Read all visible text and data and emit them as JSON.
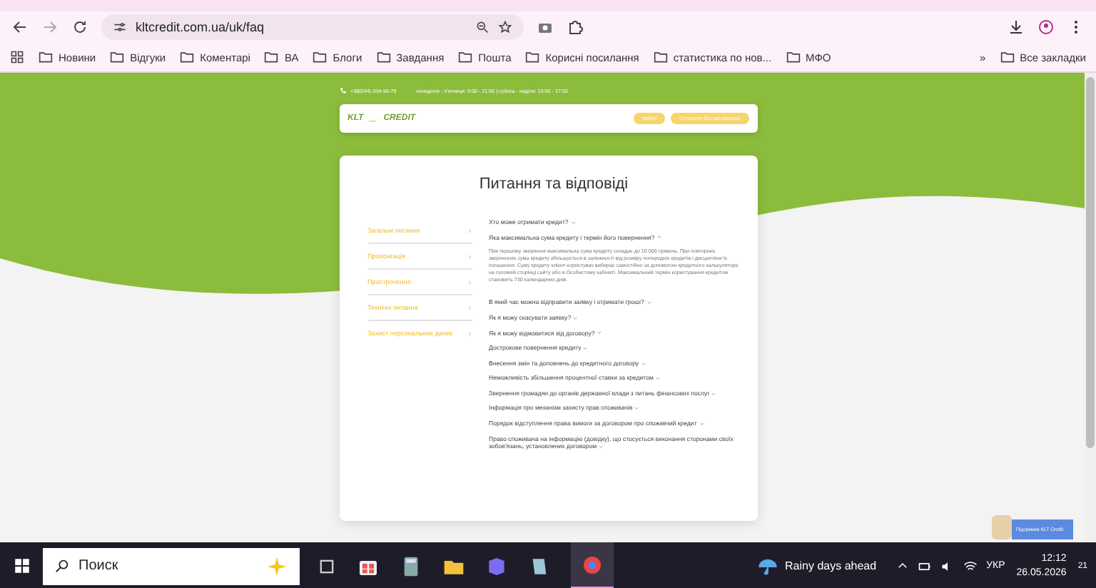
{
  "browser": {
    "url": "kltcredit.com.ua/uk/faq",
    "bookmarks": [
      "Новини",
      "Відгуки",
      "Коментарі",
      "ВА",
      "Блоги",
      "Завдання",
      "Пошта",
      "Корисні посилання",
      "статистика по нов...",
      "МФО"
    ],
    "more": "»",
    "all_bookmarks": "Все закладки"
  },
  "site": {
    "phone": "+38(044)-334-90-79",
    "hours": "понеділок - п'ятниця: 9:00 - 21:00 | субота - неділя: 10:00 - 17:00",
    "logo_left": "KLT",
    "logo_right": "CREDIT",
    "login": "Увійти",
    "pay": "Сплатити без авторизації"
  },
  "faq": {
    "title": "Питання та відповіді",
    "categories": [
      "Загальні питання",
      "Пролонгація",
      "Прострочення",
      "Технічні питання",
      "Захист персональних даних"
    ],
    "questions": [
      {
        "text": "Хто може отримати кредит?",
        "expanded": false
      },
      {
        "text": "Яка максимальна сума кредиту і термін його повернення?",
        "expanded": true,
        "answer": "При першому зверненні максимальна сума кредиту складає до 10 000 гривень. При повторних зверненнях сума кредиту збільшується в залежності від розміру попередніх кредитів і дисципліни їх погашення. Суму кредиту клієнт-користувач вибирає самостійно за допомогою кредитного калькулятора на головній сторінці сайту або в Особистому кабінеті. Максимальний термін користування кредитом становить 730 календарних днів."
      },
      {
        "text": "В який час можна відправити заявку і отримати гроші?",
        "expanded": false
      },
      {
        "text": "Як я можу скасувати заявку?",
        "expanded": false
      },
      {
        "text": "Як я можу відмовитися від договору?",
        "expanded": false
      },
      {
        "text": "Дострокове повернення кредиту",
        "expanded": false
      },
      {
        "text": "Внесення змін та доповнень до кредитного договору",
        "expanded": false
      },
      {
        "text": "Неможливість збільшення процентної ставки за кредитом",
        "expanded": false
      },
      {
        "text": "Звернення громадян до органів державної влади з питань фінансових послуг",
        "expanded": false
      },
      {
        "text": "Інформація про механізм захисту прав споживачів",
        "expanded": false
      },
      {
        "text": "Порядок відступлення права вимоги за договором про споживчий кредит",
        "expanded": false
      },
      {
        "text": "Право споживача на інформацію (довідку), що стосується виконання сторонами своїх зобов'язань, установлених договором",
        "expanded": false
      }
    ]
  },
  "chat": {
    "title": "Підтримка KLT Credit"
  },
  "taskbar": {
    "search_placeholder": "Поиск",
    "weather": "Rainy days ahead",
    "language": "УКР",
    "time": "12:12",
    "date": "26.05.2026",
    "notifications": "21"
  }
}
